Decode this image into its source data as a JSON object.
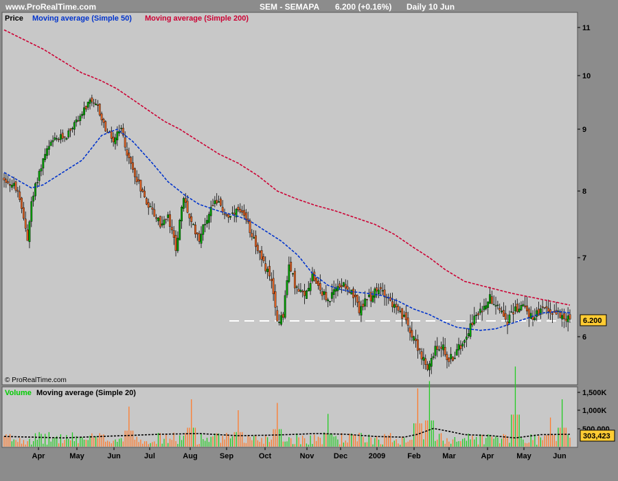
{
  "header": {
    "site": "www.ProRealTime.com",
    "instrument": "SEM - SEMAPA",
    "quote": "6.200 (+0.16%)",
    "period": "Daily  10 Jun"
  },
  "price_panel": {
    "legend": [
      {
        "label": "Price",
        "color": "#000000"
      },
      {
        "label": "Moving average (Simple 50)",
        "color": "#0033cc"
      },
      {
        "label": "Moving average (Simple 200)",
        "color": "#cc0033"
      }
    ],
    "y_ticks": [
      "6",
      "7",
      "8",
      "9",
      "10",
      "11"
    ],
    "last_price_label": "6.200",
    "watermark": "© ProRealTime.com"
  },
  "volume_panel": {
    "legend": [
      {
        "label": "Volume",
        "color": "#00cc00"
      },
      {
        "label": "Moving average (Simple 20)",
        "color": "#000000"
      }
    ],
    "y_ticks": [
      "500,000",
      "1,000K",
      "1,500K"
    ],
    "last_volume_label": "303,423"
  },
  "x_axis": {
    "ticks": [
      "Apr",
      "May",
      "Jun",
      "Jul",
      "Aug",
      "Sep",
      "Oct",
      "Nov",
      "Dec",
      "2009",
      "Feb",
      "Mar",
      "Apr",
      "May",
      "Jun"
    ]
  },
  "colors": {
    "panel_bg": "#c8c8c8",
    "frame_bg": "#8c8c8c",
    "up_candle": "#00a000",
    "down_candle": "#e06020",
    "ma50": "#0033cc",
    "ma200": "#cc0033",
    "price_label_bg": "#ffcc33"
  },
  "chart_data": {
    "type": "line",
    "title": "SEM - SEMAPA",
    "price_anchors": [
      [
        0,
        8.2
      ],
      [
        6,
        8.05
      ],
      [
        10,
        7.6
      ],
      [
        12,
        7.3
      ],
      [
        14,
        7.8
      ],
      [
        17,
        8.2
      ],
      [
        21,
        8.6
      ],
      [
        25,
        8.8
      ],
      [
        32,
        8.9
      ],
      [
        38,
        9.2
      ],
      [
        44,
        9.5
      ],
      [
        48,
        9.4
      ],
      [
        52,
        9.0
      ],
      [
        56,
        8.8
      ],
      [
        60,
        9.0
      ],
      [
        64,
        8.5
      ],
      [
        68,
        8.2
      ],
      [
        72,
        7.9
      ],
      [
        76,
        7.7
      ],
      [
        80,
        7.5
      ],
      [
        84,
        7.6
      ],
      [
        88,
        7.15
      ],
      [
        92,
        7.9
      ],
      [
        96,
        7.5
      ],
      [
        100,
        7.3
      ],
      [
        104,
        7.6
      ],
      [
        108,
        7.9
      ],
      [
        112,
        7.7
      ],
      [
        116,
        7.6
      ],
      [
        120,
        7.7
      ],
      [
        124,
        7.55
      ],
      [
        128,
        7.3
      ],
      [
        132,
        6.95
      ],
      [
        136,
        6.8
      ],
      [
        140,
        6.2
      ],
      [
        143,
        6.3
      ],
      [
        146,
        6.9
      ],
      [
        150,
        6.6
      ],
      [
        154,
        6.5
      ],
      [
        158,
        6.8
      ],
      [
        162,
        6.6
      ],
      [
        166,
        6.45
      ],
      [
        170,
        6.6
      ],
      [
        174,
        6.7
      ],
      [
        178,
        6.55
      ],
      [
        182,
        6.35
      ],
      [
        186,
        6.45
      ],
      [
        190,
        6.55
      ],
      [
        194,
        6.6
      ],
      [
        198,
        6.45
      ],
      [
        202,
        6.3
      ],
      [
        206,
        6.2
      ],
      [
        210,
        6.0
      ],
      [
        214,
        5.75
      ],
      [
        217,
        5.55
      ],
      [
        220,
        5.8
      ],
      [
        224,
        5.9
      ],
      [
        228,
        5.7
      ],
      [
        232,
        5.8
      ],
      [
        236,
        6.0
      ],
      [
        240,
        6.2
      ],
      [
        244,
        6.3
      ],
      [
        248,
        6.5
      ],
      [
        252,
        6.45
      ],
      [
        256,
        6.3
      ],
      [
        258,
        6.2
      ],
      [
        262,
        6.35
      ],
      [
        266,
        6.4
      ],
      [
        270,
        6.25
      ],
      [
        274,
        6.3
      ],
      [
        278,
        6.35
      ],
      [
        282,
        6.3
      ],
      [
        286,
        6.3
      ],
      [
        290,
        6.2
      ]
    ],
    "ma50_anchors": [
      [
        0,
        8.3
      ],
      [
        14,
        8.05
      ],
      [
        20,
        8.1
      ],
      [
        30,
        8.3
      ],
      [
        40,
        8.5
      ],
      [
        50,
        8.9
      ],
      [
        58,
        9.0
      ],
      [
        66,
        8.8
      ],
      [
        76,
        8.45
      ],
      [
        84,
        8.15
      ],
      [
        92,
        7.95
      ],
      [
        100,
        7.8
      ],
      [
        110,
        7.7
      ],
      [
        120,
        7.62
      ],
      [
        126,
        7.55
      ],
      [
        134,
        7.4
      ],
      [
        142,
        7.25
      ],
      [
        150,
        7.05
      ],
      [
        158,
        6.8
      ],
      [
        166,
        6.65
      ],
      [
        172,
        6.6
      ],
      [
        178,
        6.57
      ],
      [
        186,
        6.55
      ],
      [
        194,
        6.52
      ],
      [
        202,
        6.45
      ],
      [
        210,
        6.35
      ],
      [
        218,
        6.28
      ],
      [
        226,
        6.18
      ],
      [
        232,
        6.12
      ],
      [
        238,
        6.1
      ],
      [
        244,
        6.08
      ],
      [
        252,
        6.1
      ],
      [
        258,
        6.15
      ],
      [
        264,
        6.2
      ],
      [
        270,
        6.25
      ],
      [
        276,
        6.3
      ],
      [
        284,
        6.32
      ],
      [
        290,
        6.3
      ]
    ],
    "ma200_anchors": [
      [
        0,
        10.95
      ],
      [
        10,
        10.75
      ],
      [
        20,
        10.55
      ],
      [
        30,
        10.3
      ],
      [
        40,
        10.05
      ],
      [
        50,
        9.9
      ],
      [
        58,
        9.75
      ],
      [
        66,
        9.55
      ],
      [
        74,
        9.35
      ],
      [
        82,
        9.15
      ],
      [
        90,
        9.0
      ],
      [
        100,
        8.8
      ],
      [
        110,
        8.6
      ],
      [
        120,
        8.45
      ],
      [
        130,
        8.25
      ],
      [
        140,
        8.0
      ],
      [
        150,
        7.88
      ],
      [
        160,
        7.78
      ],
      [
        170,
        7.7
      ],
      [
        180,
        7.6
      ],
      [
        190,
        7.5
      ],
      [
        200,
        7.35
      ],
      [
        210,
        7.15
      ],
      [
        218,
        7.0
      ],
      [
        226,
        6.85
      ],
      [
        236,
        6.7
      ],
      [
        244,
        6.65
      ],
      [
        252,
        6.6
      ],
      [
        260,
        6.55
      ],
      [
        270,
        6.5
      ],
      [
        280,
        6.45
      ],
      [
        290,
        6.4
      ]
    ],
    "volume_ma20_anchors": [
      [
        0,
        0.28
      ],
      [
        30,
        0.24
      ],
      [
        60,
        0.3
      ],
      [
        80,
        0.34
      ],
      [
        100,
        0.36
      ],
      [
        120,
        0.3
      ],
      [
        140,
        0.32
      ],
      [
        160,
        0.36
      ],
      [
        175,
        0.34
      ],
      [
        190,
        0.28
      ],
      [
        205,
        0.26
      ],
      [
        212,
        0.34
      ],
      [
        220,
        0.5
      ],
      [
        228,
        0.42
      ],
      [
        236,
        0.33
      ],
      [
        250,
        0.3
      ],
      [
        262,
        0.24
      ],
      [
        275,
        0.33
      ],
      [
        290,
        0.34
      ]
    ],
    "volume_spikes": [
      [
        64,
        1.1
      ],
      [
        96,
        1.3
      ],
      [
        120,
        1.0
      ],
      [
        140,
        1.2
      ],
      [
        166,
        0.9
      ],
      [
        212,
        1.6
      ],
      [
        218,
        1.8
      ],
      [
        262,
        2.2
      ],
      [
        280,
        0.8
      ],
      [
        286,
        1.3
      ]
    ],
    "last_close": 6.2,
    "last_volume": 303423,
    "bars": 291,
    "ylim_price": [
      5.6,
      11.3
    ],
    "ylim_volume": [
      0,
      2.3
    ],
    "grid": false
  }
}
